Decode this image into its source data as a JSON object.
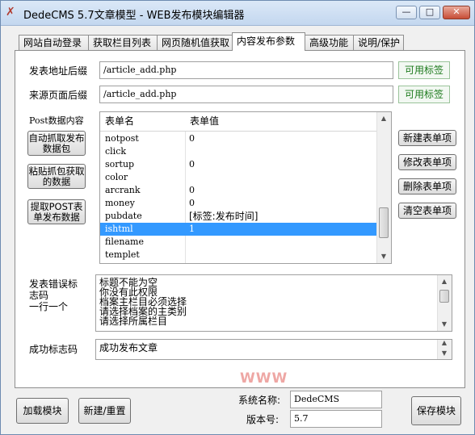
{
  "window": {
    "title": "DedeCMS 5.7文章模型 - WEB发布模块编辑器",
    "controls": {
      "minimize": "—",
      "maximize": "□",
      "close": "✕"
    }
  },
  "tabs": [
    "网站自动登录",
    "获取栏目列表",
    "网页随机值获取",
    "内容发布参数",
    "高级功能",
    "说明/保护"
  ],
  "active_tab": "内容发布参数",
  "form": {
    "post_url_label": "发表地址后缀",
    "post_url_value": "/article_add.php",
    "referer_label": "来源页面后缀",
    "referer_value": "/article_add.php",
    "tags_button": "可用标签"
  },
  "post_data": {
    "label": "Post数据内容",
    "left_buttons": [
      "自动抓取发布数据包",
      "粘贴抓包获取的数据",
      "提取POST表单发布数据"
    ],
    "columns": [
      "表单名",
      "表单值"
    ],
    "rows": [
      {
        "name": "notpost",
        "value": "0"
      },
      {
        "name": "click",
        "value": ""
      },
      {
        "name": "sortup",
        "value": "0"
      },
      {
        "name": "color",
        "value": ""
      },
      {
        "name": "arcrank",
        "value": "0"
      },
      {
        "name": "money",
        "value": "0"
      },
      {
        "name": "pubdate",
        "value": "[标签:发布时间]"
      },
      {
        "name": "ishtml",
        "value": "1"
      },
      {
        "name": "filename",
        "value": ""
      },
      {
        "name": "templet",
        "value": ""
      }
    ],
    "selected_row": "ishtml",
    "right_buttons": [
      "新建表单项",
      "修改表单项",
      "删除表单项",
      "清空表单项"
    ]
  },
  "error_codes": {
    "label_lines": [
      "发表错误标",
      "志码",
      "一行一个"
    ],
    "lines": [
      "标题不能为空",
      "你没有此权限",
      "档案主栏目必须选择",
      "请选择档案的主类别",
      "请选择所属栏目"
    ]
  },
  "success": {
    "label": "成功标志码",
    "value": "成功发布文章"
  },
  "footer": {
    "load_button": "加载模块",
    "new_button": "新建/重置",
    "system_name_label": "系统名称:",
    "system_name_value": "DedeCMS",
    "version_label": "版本号:",
    "version_value": "5.7",
    "save_button": "保存模块"
  },
  "watermark": "WWW"
}
